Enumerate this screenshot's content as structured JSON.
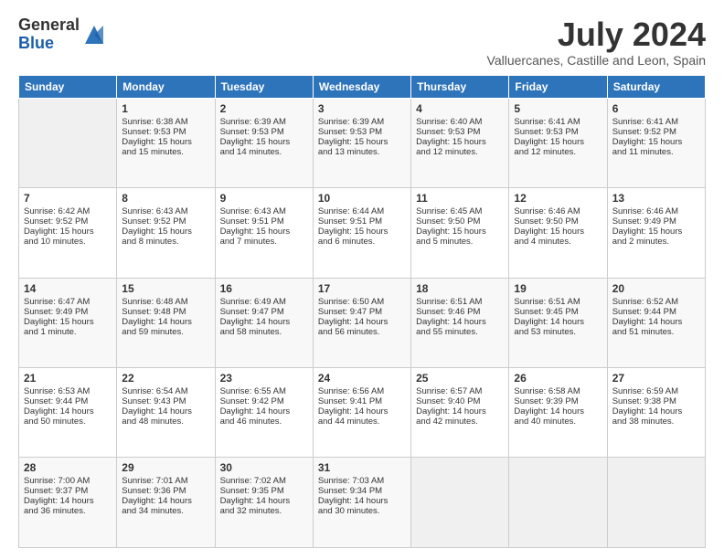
{
  "logo": {
    "general": "General",
    "blue": "Blue"
  },
  "title": "July 2024",
  "location": "Valluercanes, Castille and Leon, Spain",
  "headers": [
    "Sunday",
    "Monday",
    "Tuesday",
    "Wednesday",
    "Thursday",
    "Friday",
    "Saturday"
  ],
  "weeks": [
    [
      {
        "day": "",
        "info": ""
      },
      {
        "day": "1",
        "info": "Sunrise: 6:38 AM\nSunset: 9:53 PM\nDaylight: 15 hours\nand 15 minutes."
      },
      {
        "day": "2",
        "info": "Sunrise: 6:39 AM\nSunset: 9:53 PM\nDaylight: 15 hours\nand 14 minutes."
      },
      {
        "day": "3",
        "info": "Sunrise: 6:39 AM\nSunset: 9:53 PM\nDaylight: 15 hours\nand 13 minutes."
      },
      {
        "day": "4",
        "info": "Sunrise: 6:40 AM\nSunset: 9:53 PM\nDaylight: 15 hours\nand 12 minutes."
      },
      {
        "day": "5",
        "info": "Sunrise: 6:41 AM\nSunset: 9:53 PM\nDaylight: 15 hours\nand 12 minutes."
      },
      {
        "day": "6",
        "info": "Sunrise: 6:41 AM\nSunset: 9:52 PM\nDaylight: 15 hours\nand 11 minutes."
      }
    ],
    [
      {
        "day": "7",
        "info": "Sunrise: 6:42 AM\nSunset: 9:52 PM\nDaylight: 15 hours\nand 10 minutes."
      },
      {
        "day": "8",
        "info": "Sunrise: 6:43 AM\nSunset: 9:52 PM\nDaylight: 15 hours\nand 8 minutes."
      },
      {
        "day": "9",
        "info": "Sunrise: 6:43 AM\nSunset: 9:51 PM\nDaylight: 15 hours\nand 7 minutes."
      },
      {
        "day": "10",
        "info": "Sunrise: 6:44 AM\nSunset: 9:51 PM\nDaylight: 15 hours\nand 6 minutes."
      },
      {
        "day": "11",
        "info": "Sunrise: 6:45 AM\nSunset: 9:50 PM\nDaylight: 15 hours\nand 5 minutes."
      },
      {
        "day": "12",
        "info": "Sunrise: 6:46 AM\nSunset: 9:50 PM\nDaylight: 15 hours\nand 4 minutes."
      },
      {
        "day": "13",
        "info": "Sunrise: 6:46 AM\nSunset: 9:49 PM\nDaylight: 15 hours\nand 2 minutes."
      }
    ],
    [
      {
        "day": "14",
        "info": "Sunrise: 6:47 AM\nSunset: 9:49 PM\nDaylight: 15 hours\nand 1 minute."
      },
      {
        "day": "15",
        "info": "Sunrise: 6:48 AM\nSunset: 9:48 PM\nDaylight: 14 hours\nand 59 minutes."
      },
      {
        "day": "16",
        "info": "Sunrise: 6:49 AM\nSunset: 9:47 PM\nDaylight: 14 hours\nand 58 minutes."
      },
      {
        "day": "17",
        "info": "Sunrise: 6:50 AM\nSunset: 9:47 PM\nDaylight: 14 hours\nand 56 minutes."
      },
      {
        "day": "18",
        "info": "Sunrise: 6:51 AM\nSunset: 9:46 PM\nDaylight: 14 hours\nand 55 minutes."
      },
      {
        "day": "19",
        "info": "Sunrise: 6:51 AM\nSunset: 9:45 PM\nDaylight: 14 hours\nand 53 minutes."
      },
      {
        "day": "20",
        "info": "Sunrise: 6:52 AM\nSunset: 9:44 PM\nDaylight: 14 hours\nand 51 minutes."
      }
    ],
    [
      {
        "day": "21",
        "info": "Sunrise: 6:53 AM\nSunset: 9:44 PM\nDaylight: 14 hours\nand 50 minutes."
      },
      {
        "day": "22",
        "info": "Sunrise: 6:54 AM\nSunset: 9:43 PM\nDaylight: 14 hours\nand 48 minutes."
      },
      {
        "day": "23",
        "info": "Sunrise: 6:55 AM\nSunset: 9:42 PM\nDaylight: 14 hours\nand 46 minutes."
      },
      {
        "day": "24",
        "info": "Sunrise: 6:56 AM\nSunset: 9:41 PM\nDaylight: 14 hours\nand 44 minutes."
      },
      {
        "day": "25",
        "info": "Sunrise: 6:57 AM\nSunset: 9:40 PM\nDaylight: 14 hours\nand 42 minutes."
      },
      {
        "day": "26",
        "info": "Sunrise: 6:58 AM\nSunset: 9:39 PM\nDaylight: 14 hours\nand 40 minutes."
      },
      {
        "day": "27",
        "info": "Sunrise: 6:59 AM\nSunset: 9:38 PM\nDaylight: 14 hours\nand 38 minutes."
      }
    ],
    [
      {
        "day": "28",
        "info": "Sunrise: 7:00 AM\nSunset: 9:37 PM\nDaylight: 14 hours\nand 36 minutes."
      },
      {
        "day": "29",
        "info": "Sunrise: 7:01 AM\nSunset: 9:36 PM\nDaylight: 14 hours\nand 34 minutes."
      },
      {
        "day": "30",
        "info": "Sunrise: 7:02 AM\nSunset: 9:35 PM\nDaylight: 14 hours\nand 32 minutes."
      },
      {
        "day": "31",
        "info": "Sunrise: 7:03 AM\nSunset: 9:34 PM\nDaylight: 14 hours\nand 30 minutes."
      },
      {
        "day": "",
        "info": ""
      },
      {
        "day": "",
        "info": ""
      },
      {
        "day": "",
        "info": ""
      }
    ]
  ]
}
